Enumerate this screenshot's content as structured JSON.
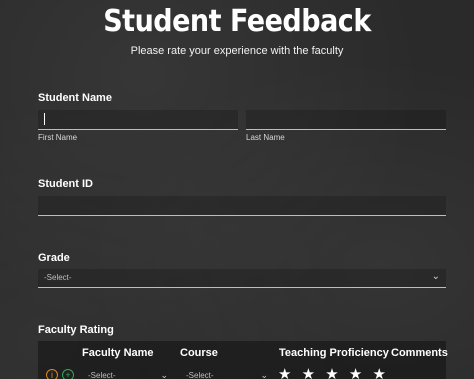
{
  "form": {
    "title": "Student Feedback",
    "subtitle": "Please rate your experience with the faculty"
  },
  "student_name": {
    "label": "Student Name",
    "first_label": "First Name",
    "last_label": "Last Name",
    "first_value": "",
    "last_value": ""
  },
  "student_id": {
    "label": "Student ID",
    "value": ""
  },
  "grade": {
    "label": "Grade",
    "selected": "-Select-"
  },
  "faculty_rating": {
    "label": "Faculty Rating",
    "columns": [
      "Faculty Name",
      "Course",
      "Teaching Proficiency",
      "Comments"
    ],
    "row": {
      "faculty_select": "-Select-",
      "course_select": "-Select-",
      "stars": "★ ★ ★ ★ ★"
    }
  },
  "icons": {
    "info": "info-icon",
    "add": "plus-circle-icon",
    "dropdown": "chevron-down-icon",
    "star": "star-icon"
  },
  "colors": {
    "info_icon": "#e08a1e",
    "add_icon": "#3aa55b",
    "background": "#2a2a2a"
  }
}
